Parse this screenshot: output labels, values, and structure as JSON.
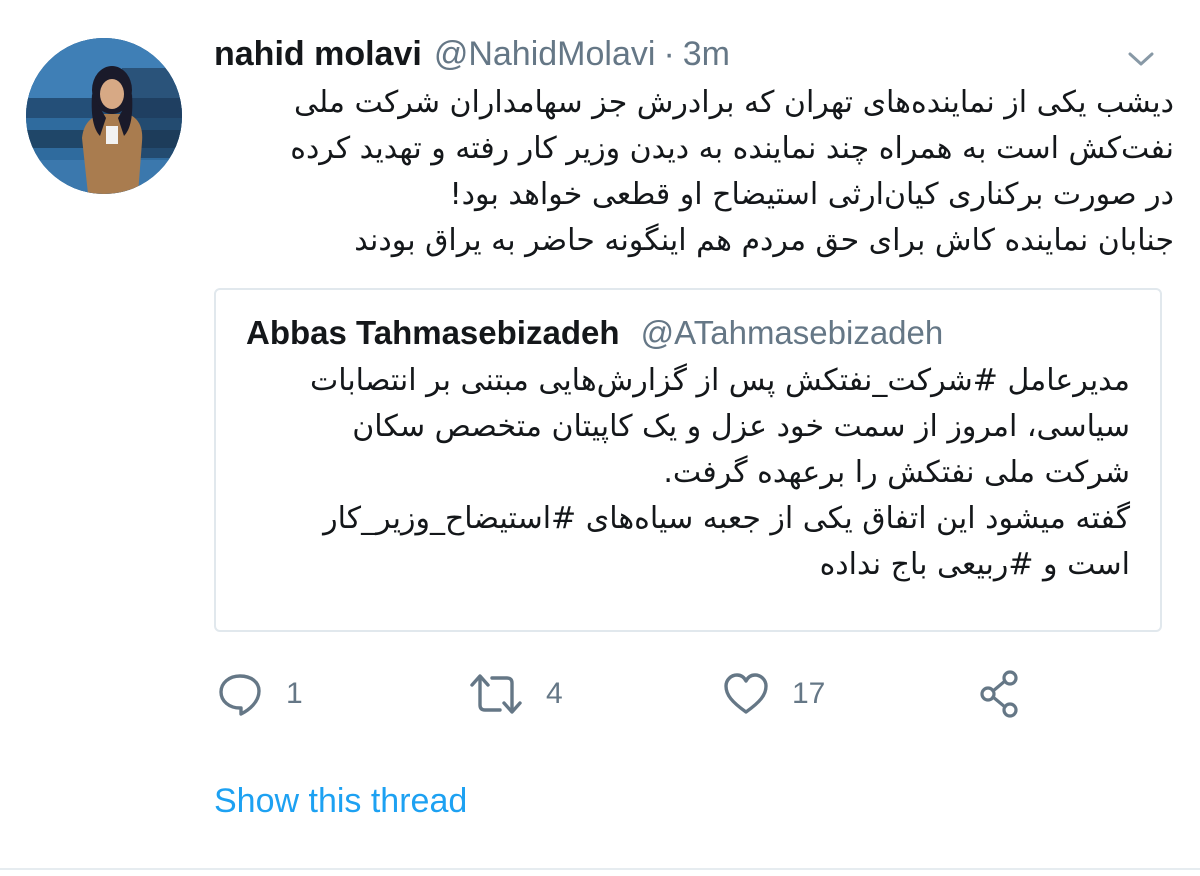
{
  "author": {
    "display_name": "nahid molavi",
    "handle": "@NahidMolavi",
    "separator": "·",
    "time": "3m"
  },
  "tweet": {
    "lines": [
      "دیشب یکی از نماینده‌های تهران که برادرش جز سهامداران شرکت ملی",
      "نفت‌کش است به همراه چند نماینده به دیدن وزیر کار رفته و تهدید کرده",
      "در صورت برکناری کیان‌ارثی استیضاح او قطعی خواهد بود!",
      "جنابان نماینده کاش برای حق مردم هم اینگونه حاضر به یراق بودند"
    ]
  },
  "quoted_tweet": {
    "display_name": "Abbas Tahmasebizadeh",
    "handle": "@ATahmasebizadeh",
    "lines": [
      "مدیرعامل #شرکت_نفتکش پس از گزارش‌هایی مبتنی بر انتصابات",
      "سیاسی، امروز از سمت خود عزل و یک کاپیتان متخصص سکان",
      "شرکت ملی نفتکش را برعهده گرفت.",
      "گفته میشود این اتفاق یکی از جعبه سیاه‌های #استیضاح_وزیر_کار",
      "است و #ربیعی باج نداده"
    ]
  },
  "actions": {
    "reply_count": "1",
    "retweet_count": "4",
    "like_count": "17"
  },
  "show_thread_label": "Show this thread",
  "icons": {
    "menu": "chevron-down-icon",
    "reply": "reply-icon",
    "retweet": "retweet-icon",
    "like": "heart-icon",
    "share": "share-icon"
  },
  "colors": {
    "link": "#1da1f2",
    "secondary_text": "#657786",
    "border": "#e1e8ed"
  }
}
